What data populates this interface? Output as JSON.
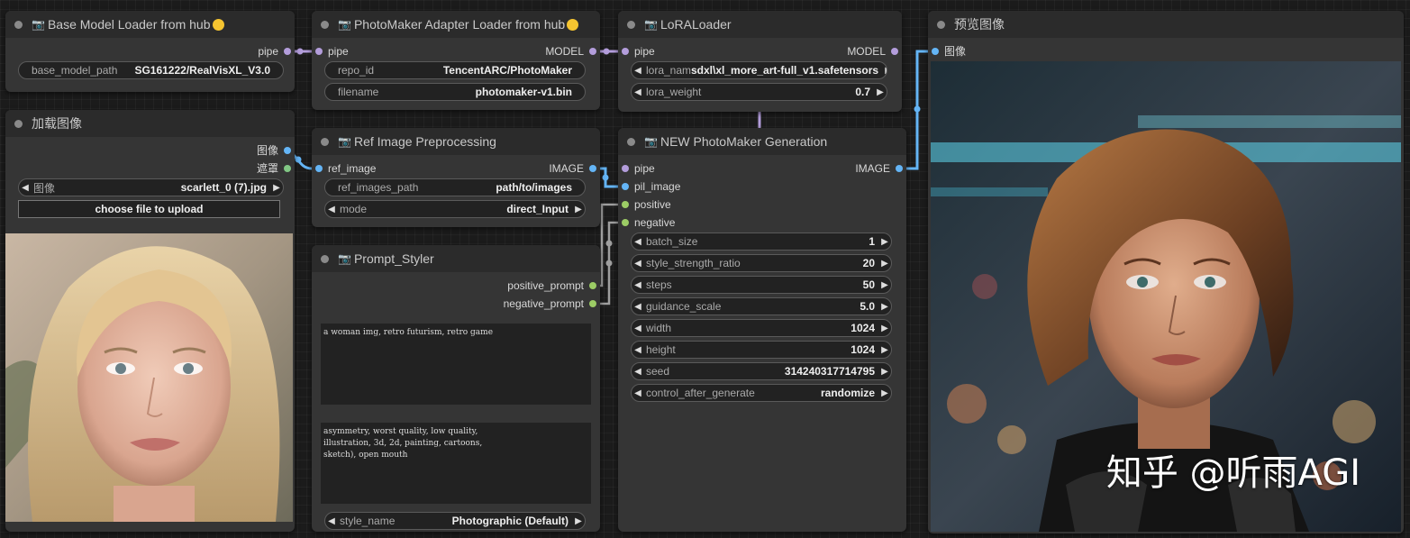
{
  "nodes": {
    "base_loader": {
      "title": "Base Model Loader from hub",
      "output": "pipe",
      "widget_label": "base_model_path",
      "widget_value": "SG161222/RealVisXL_V3.0"
    },
    "load_image": {
      "title": "加载图像",
      "outputs": [
        "图像",
        "遮罩"
      ],
      "combo_label": "图像",
      "combo_value": "scarlett_0 (7).jpg",
      "upload_label": "choose file to upload"
    },
    "adapter_loader": {
      "title": "PhotoMaker Adapter Loader from hub",
      "input": "pipe",
      "output": "MODEL",
      "widgets": [
        {
          "label": "repo_id",
          "value": "TencentARC/PhotoMaker"
        },
        {
          "label": "filename",
          "value": "photomaker-v1.bin"
        }
      ]
    },
    "ref_preprocess": {
      "title": "Ref Image Preprocessing",
      "input": "ref_image",
      "output": "IMAGE",
      "path_label": "ref_images_path",
      "path_value": "path/to/images",
      "mode_label": "mode",
      "mode_value": "direct_Input"
    },
    "prompt_styler": {
      "title": "Prompt_Styler",
      "outputs": [
        "positive_prompt",
        "negative_prompt"
      ],
      "positive_text": "a woman img, retro futurism, retro game",
      "negative_text": "asymmetry, worst quality, low quality,\nillustration, 3d, 2d, painting, cartoons,\nsketch), open mouth",
      "style_label": "style_name",
      "style_value": "Photographic (Default)"
    },
    "lora_loader": {
      "title": "LoRALoader",
      "input": "pipe",
      "output": "MODEL",
      "lora_name_label": "lora_name",
      "lora_name_value": "sdxl\\xl_more_art-full_v1.safetensors",
      "lora_weight_label": "lora_weight",
      "lora_weight_value": "0.7"
    },
    "generation": {
      "title": "NEW PhotoMaker Generation",
      "inputs": [
        "pipe",
        "pil_image",
        "positive",
        "negative"
      ],
      "output": "IMAGE",
      "widgets": [
        {
          "label": "batch_size",
          "value": "1"
        },
        {
          "label": "style_strength_ratio",
          "value": "20"
        },
        {
          "label": "steps",
          "value": "50"
        },
        {
          "label": "guidance_scale",
          "value": "5.0"
        },
        {
          "label": "width",
          "value": "1024"
        },
        {
          "label": "height",
          "value": "1024"
        },
        {
          "label": "seed",
          "value": "314240317714795"
        },
        {
          "label": "control_after_generate",
          "value": "randomize"
        }
      ]
    },
    "preview": {
      "title": "预览图像",
      "input": "图像",
      "watermark": "知乎 @听雨AGI"
    }
  },
  "icons": {
    "header_dot": "collapse-dot-icon",
    "title_prefix": "camera-icon",
    "title_suffix": "smile-emoji-icon",
    "arrow_left": "arrow-left-icon",
    "arrow_right": "arrow-right-icon"
  },
  "colors": {
    "canvas": "#1b1b1b",
    "node_body": "#353535",
    "node_header": "#2b2b2b",
    "pipe_link": "#b39ddb",
    "image_link": "#64b5f6",
    "string_link": "#9e9e9e"
  }
}
